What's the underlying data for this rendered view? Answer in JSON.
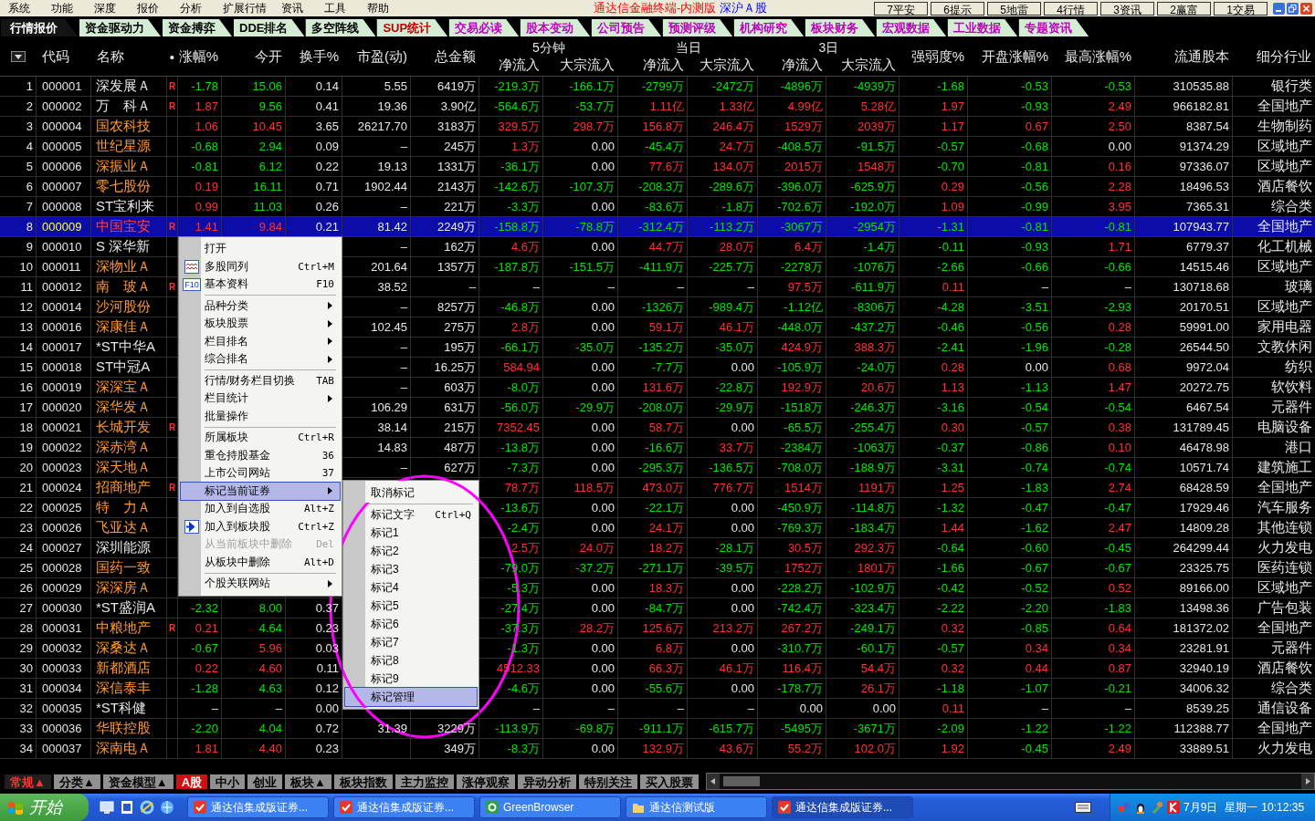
{
  "menubar": {
    "items": [
      "系统",
      "功能",
      "深度",
      "报价",
      "分析",
      "扩展行情",
      "资讯",
      "工具",
      "帮助"
    ],
    "title": "通达信金融终端-内测版",
    "market": "深沪Ａ股",
    "quick_buttons": [
      "7平安",
      "6提示",
      "5地雷",
      "4行情",
      "3资讯",
      "2赢富",
      "1交易"
    ]
  },
  "tabs": [
    {
      "label": "行情报价",
      "color": "#ffffff",
      "selected": true
    },
    {
      "label": "资金驱动力",
      "color": "#000000",
      "selected": false
    },
    {
      "label": "资金搏弈",
      "color": "#000000",
      "selected": false
    },
    {
      "label": "DDE排名",
      "color": "#000000",
      "selected": false
    },
    {
      "label": "多空阵线",
      "color": "#000000",
      "selected": false
    },
    {
      "label": "SUP统计",
      "color": "#c00000",
      "selected": false
    },
    {
      "label": "交易必读",
      "color": "#c000c0",
      "selected": false
    },
    {
      "label": "股本变动",
      "color": "#c000c0",
      "selected": false
    },
    {
      "label": "公司预告",
      "color": "#c000c0",
      "selected": false
    },
    {
      "label": "预测评级",
      "color": "#c000c0",
      "selected": false
    },
    {
      "label": "机构研究",
      "color": "#c000c0",
      "selected": false
    },
    {
      "label": "板块财务",
      "color": "#c000c0",
      "selected": false
    },
    {
      "label": "宏观数据",
      "color": "#c000c0",
      "selected": false
    },
    {
      "label": "工业数据",
      "color": "#c000c0",
      "selected": false
    },
    {
      "label": "专题资讯",
      "color": "#c000c0",
      "selected": false
    }
  ],
  "table": {
    "columns": [
      "代码",
      "名称",
      "•",
      "涨幅%",
      "今开",
      "换手%",
      "市盈(动)",
      "总金额"
    ],
    "groups": [
      {
        "label": "5分钟",
        "sub": [
          "净流入",
          "大宗流入"
        ]
      },
      {
        "label": "当日",
        "sub": [
          "净流入",
          "大宗流入"
        ]
      },
      {
        "label": "3日",
        "sub": [
          "净流入",
          "大宗流入"
        ]
      }
    ],
    "columns_after": [
      "强弱度%",
      "开盘涨幅%",
      "最高涨幅%",
      "流通股本",
      "细分行业"
    ],
    "rows": [
      {
        "no": "1",
        "color": "#e6e6e6",
        "selected": false,
        "open_up": false,
        "cells": [
          "000001",
          "深发展Ａ",
          "R",
          "-1.78",
          "15.06",
          "0.14",
          "5.55",
          "6419万",
          "-219.3万",
          "-166.1万",
          "-2799万",
          "-2472万",
          "-4896万",
          "-4939万",
          "-1.68",
          "-0.53",
          "-0.53",
          "310535.88",
          "银行类"
        ]
      },
      {
        "no": "2",
        "color": "#e6e6e6",
        "selected": false,
        "open_up": false,
        "cells": [
          "000002",
          "万　科Ａ",
          "R",
          "1.87",
          "9.56",
          "0.41",
          "19.36",
          "3.90亿",
          "-564.6万",
          "-53.7万",
          "1.11亿",
          "1.33亿",
          "4.99亿",
          "5.28亿",
          "1.97",
          "-0.93",
          "2.49",
          "966182.81",
          "全国地产"
        ]
      },
      {
        "no": "3",
        "color": "#ff9933",
        "selected": false,
        "open_up": true,
        "cells": [
          "000004",
          "国农科技",
          null,
          "1.06",
          "10.45",
          "3.65",
          "26217.70",
          "3183万",
          "329.5万",
          "298.7万",
          "156.8万",
          "246.4万",
          "1529万",
          "2039万",
          "1.17",
          "0.67",
          "2.50",
          "8387.54",
          "生物制药"
        ]
      },
      {
        "no": "4",
        "color": "#ff9933",
        "selected": false,
        "open_up": false,
        "cells": [
          "000005",
          "世纪星源",
          null,
          "-0.68",
          "2.94",
          "0.09",
          "–",
          "245万",
          "1.3万",
          "0.00",
          "-45.4万",
          "24.7万",
          "-408.5万",
          "-91.5万",
          "-0.57",
          "-0.68",
          "0.00",
          "91374.29",
          "区域地产"
        ]
      },
      {
        "no": "5",
        "color": "#ff9933",
        "selected": false,
        "open_up": false,
        "cells": [
          "000006",
          "深振业Ａ",
          null,
          "-0.81",
          "6.12",
          "0.22",
          "19.13",
          "1331万",
          "-36.1万",
          "0.00",
          "77.6万",
          "134.0万",
          "2015万",
          "1548万",
          "-0.70",
          "-0.81",
          "0.16",
          "97336.07",
          "区域地产"
        ]
      },
      {
        "no": "6",
        "color": "#ff9933",
        "selected": false,
        "open_up": false,
        "cells": [
          "000007",
          "零七股份",
          null,
          "0.19",
          "16.11",
          "0.71",
          "1902.44",
          "2143万",
          "-142.6万",
          "-107.3万",
          "-208.3万",
          "-289.6万",
          "-396.0万",
          "-625.9万",
          "0.29",
          "-0.56",
          "2.28",
          "18496.53",
          "酒店餐饮"
        ]
      },
      {
        "no": "7",
        "color": "#e6e6e6",
        "selected": false,
        "open_up": false,
        "cells": [
          "000008",
          "ST宝利来",
          null,
          "0.99",
          "11.03",
          "0.26",
          "–",
          "221万",
          "-3.3万",
          "0.00",
          "-83.6万",
          "-1.8万",
          "-702.6万",
          "-192.0万",
          "1.09",
          "-0.99",
          "3.95",
          "7365.31",
          "综合类"
        ]
      },
      {
        "no": "8",
        "selected": true,
        "open_up": true,
        "cells": [
          "000009",
          "中国宝安",
          "R",
          "1.41",
          "9.84",
          "0.21",
          "81.42",
          "2249万",
          "-158.8万",
          "-78.8万",
          "-312.4万",
          "-113.2万",
          "-3067万",
          "-2954万",
          "-1.31",
          "-0.81",
          "-0.81",
          "107943.77",
          "全国地产"
        ]
      },
      {
        "no": "9",
        "color": "#e6e6e6",
        "selected": false,
        "cells": [
          "000010",
          "S 深华新",
          null,
          null,
          null,
          null,
          "–",
          "162万",
          "4.6万",
          "0.00",
          "44.7万",
          "28.0万",
          "6.4万",
          "-1.4万",
          "-0.11",
          "-0.93",
          "1.71",
          "6779.37",
          "化工机械"
        ]
      },
      {
        "no": "10",
        "color": "#ff9933",
        "selected": false,
        "cells": [
          "000011",
          "深物业Ａ",
          null,
          null,
          null,
          null,
          "201.64",
          "1357万",
          "-187.8万",
          "-151.5万",
          "-411.9万",
          "-225.7万",
          "-2278万",
          "-1076万",
          "-2.66",
          "-0.66",
          "-0.66",
          "14515.46",
          "区域地产"
        ]
      },
      {
        "no": "11",
        "color": "#ff9933",
        "selected": false,
        "cells": [
          "000012",
          "南　玻Ａ",
          "R",
          null,
          null,
          null,
          "38.52",
          "–",
          "–",
          "–",
          "–",
          "–",
          "97.5万",
          "-611.9万",
          "0.11",
          "–",
          "–",
          "130718.68",
          "玻璃"
        ]
      },
      {
        "no": "12",
        "color": "#ff9933",
        "selected": false,
        "cells": [
          "000014",
          "沙河股份",
          null,
          null,
          null,
          null,
          "–",
          "8257万",
          "-46.8万",
          "0.00",
          "-1326万",
          "-989.4万",
          "-1.12亿",
          "-8306万",
          "-4.28",
          "-3.51",
          "-2.93",
          "20170.51",
          "区域地产"
        ]
      },
      {
        "no": "13",
        "color": "#ff9933",
        "selected": false,
        "cells": [
          "000016",
          "深康佳Ａ",
          null,
          null,
          null,
          null,
          "102.45",
          "275万",
          "2.8万",
          "0.00",
          "59.1万",
          "46.1万",
          "-448.0万",
          "-437.2万",
          "-0.46",
          "-0.56",
          "0.28",
          "59991.00",
          "家用电器"
        ]
      },
      {
        "no": "14",
        "color": "#e6e6e6",
        "selected": false,
        "cells": [
          "000017",
          "*ST中华A",
          null,
          null,
          null,
          null,
          "–",
          "195万",
          "-66.1万",
          "-35.0万",
          "-135.2万",
          "-35.0万",
          "424.9万",
          "388.3万",
          "-2.41",
          "-1.96",
          "-0.28",
          "26544.50",
          "文教休闲"
        ]
      },
      {
        "no": "15",
        "color": "#e6e6e6",
        "selected": false,
        "cells": [
          "000018",
          "ST中冠A",
          null,
          null,
          null,
          null,
          "–",
          "16.25万",
          "584.94",
          "0.00",
          "-7.7万",
          "0.00",
          "-105.9万",
          "-24.0万",
          "0.28",
          "0.00",
          "0.68",
          "9972.04",
          "纺织"
        ]
      },
      {
        "no": "16",
        "color": "#ff9933",
        "selected": false,
        "cells": [
          "000019",
          "深深宝Ａ",
          null,
          null,
          null,
          null,
          "–",
          "603万",
          "-8.0万",
          "0.00",
          "131.6万",
          "-22.8万",
          "192.9万",
          "20.6万",
          "1.13",
          "-1.13",
          "1.47",
          "20272.75",
          "软饮料"
        ]
      },
      {
        "no": "17",
        "color": "#ff9933",
        "selected": false,
        "cells": [
          "000020",
          "深华发Ａ",
          null,
          null,
          null,
          null,
          "106.29",
          "631万",
          "-56.0万",
          "-29.9万",
          "-208.0万",
          "-29.9万",
          "-1518万",
          "-246.3万",
          "-3.16",
          "-0.54",
          "-0.54",
          "6467.54",
          "元器件"
        ]
      },
      {
        "no": "18",
        "color": "#ff9933",
        "selected": false,
        "cells": [
          "000021",
          "长城开发",
          "R",
          null,
          null,
          null,
          "38.14",
          "215万",
          "7352.45",
          "0.00",
          "58.7万",
          "0.00",
          "-65.5万",
          "-255.4万",
          "0.30",
          "-0.57",
          "0.38",
          "131789.45",
          "电脑设备"
        ]
      },
      {
        "no": "19",
        "color": "#ff9933",
        "selected": false,
        "cells": [
          "000022",
          "深赤湾Ａ",
          null,
          null,
          null,
          null,
          "14.83",
          "487万",
          "-13.8万",
          "0.00",
          "-16.6万",
          "33.7万",
          "-2384万",
          "-1063万",
          "-0.37",
          "-0.86",
          "0.10",
          "46478.98",
          "港口"
        ]
      },
      {
        "no": "20",
        "color": "#ff9933",
        "selected": false,
        "cells": [
          "000023",
          "深天地Ａ",
          null,
          null,
          null,
          null,
          "–",
          "627万",
          "-7.3万",
          "0.00",
          "-295.3万",
          "-136.5万",
          "-708.0万",
          "-188.9万",
          "-3.31",
          "-0.74",
          "-0.74",
          "10571.74",
          "建筑施工"
        ]
      },
      {
        "no": "21",
        "color": "#ff9933",
        "selected": false,
        "cells": [
          "000024",
          "招商地产",
          "R",
          null,
          null,
          null,
          null,
          null,
          "78.7万",
          "118.5万",
          "473.0万",
          "776.7万",
          "1514万",
          "1191万",
          "1.25",
          "-1.83",
          "2.74",
          "68428.59",
          "全国地产"
        ]
      },
      {
        "no": "22",
        "color": "#ff9933",
        "selected": false,
        "cells": [
          "000025",
          "特　力Ａ",
          null,
          null,
          null,
          null,
          null,
          null,
          "-13.6万",
          "0.00",
          "-22.1万",
          "0.00",
          "-450.9万",
          "-114.8万",
          "-1.32",
          "-0.47",
          "-0.47",
          "17929.46",
          "汽车服务"
        ]
      },
      {
        "no": "23",
        "color": "#ff9933",
        "selected": false,
        "cells": [
          "000026",
          "飞亚达Ａ",
          null,
          null,
          null,
          null,
          null,
          null,
          "-2.4万",
          "0.00",
          "24.1万",
          "0.00",
          "-769.3万",
          "-183.4万",
          "1.44",
          "-1.62",
          "2.47",
          "14809.28",
          "其他连锁"
        ]
      },
      {
        "no": "24",
        "color": "#e6e6e6",
        "selected": false,
        "cells": [
          "000027",
          "深圳能源",
          null,
          null,
          null,
          null,
          null,
          null,
          "2.5万",
          "24.0万",
          "18.2万",
          "-28.1万",
          "30.5万",
          "292.3万",
          "-0.64",
          "-0.60",
          "-0.45",
          "264299.44",
          "火力发电"
        ]
      },
      {
        "no": "25",
        "color": "#ff9933",
        "selected": false,
        "cells": [
          "000028",
          "国药一致",
          null,
          null,
          null,
          null,
          null,
          null,
          "-79.0万",
          "-37.2万",
          "-271.1万",
          "-39.5万",
          "1752万",
          "1801万",
          "-1.66",
          "-0.67",
          "-0.67",
          "23325.75",
          "医药连锁"
        ]
      },
      {
        "no": "26",
        "color": "#ff9933",
        "selected": false,
        "cells": [
          "000029",
          "深深房Ａ",
          null,
          null,
          null,
          null,
          null,
          null,
          "-5.3万",
          "0.00",
          "18.3万",
          "0.00",
          "-228.2万",
          "-102.9万",
          "-0.42",
          "-0.52",
          "0.52",
          "89166.00",
          "区域地产"
        ]
      },
      {
        "no": "27",
        "color": "#e6e6e6",
        "selected": false,
        "open_up": false,
        "cells": [
          "000030",
          "*ST盛润A",
          null,
          "-2.32",
          "8.00",
          "0.37",
          null,
          null,
          "-27.4万",
          "0.00",
          "-84.7万",
          "0.00",
          "-742.4万",
          "-323.4万",
          "-2.22",
          "-2.20",
          "-1.83",
          "13498.36",
          "广告包装"
        ]
      },
      {
        "no": "28",
        "color": "#ff9933",
        "selected": false,
        "open_up": false,
        "cells": [
          "000031",
          "中粮地产",
          "R",
          "0.21",
          "4.64",
          "0.23",
          null,
          null,
          "-37.3万",
          "28.2万",
          "125.6万",
          "213.2万",
          "267.2万",
          "-249.1万",
          "0.32",
          "-0.85",
          "0.64",
          "181372.02",
          "全国地产"
        ]
      },
      {
        "no": "29",
        "color": "#ff9933",
        "selected": false,
        "open_up": true,
        "cells": [
          "000032",
          "深桑达Ａ",
          null,
          "-0.67",
          "5.96",
          "0.03",
          null,
          null,
          "-1.3万",
          "0.00",
          "6.8万",
          "0.00",
          "-310.7万",
          "-60.1万",
          "-0.57",
          "0.34",
          "0.34",
          "23281.91",
          "元器件"
        ]
      },
      {
        "no": "30",
        "color": "#ff9933",
        "selected": false,
        "open_up": true,
        "cells": [
          "000033",
          "新都酒店",
          null,
          "0.22",
          "4.60",
          "0.11",
          null,
          null,
          "4512.33",
          "0.00",
          "66.3万",
          "46.1万",
          "116.4万",
          "54.4万",
          "0.32",
          "0.44",
          "0.87",
          "32940.19",
          "酒店餐饮"
        ]
      },
      {
        "no": "31",
        "color": "#ff9933",
        "selected": false,
        "open_up": false,
        "cells": [
          "000034",
          "深信泰丰",
          null,
          "-1.28",
          "4.63",
          "0.12",
          null,
          null,
          "-4.6万",
          "0.00",
          "-55.6万",
          "0.00",
          "-178.7万",
          "26.1万",
          "-1.18",
          "-1.07",
          "-0.21",
          "34006.32",
          "综合类"
        ]
      },
      {
        "no": "32",
        "color": "#e6e6e6",
        "selected": false,
        "cells": [
          "000035",
          "*ST科健",
          null,
          "–",
          "–",
          "0.00",
          null,
          null,
          "–",
          "–",
          "–",
          "–",
          "0.00",
          "0.00",
          "0.11",
          "–",
          "–",
          "8539.25",
          "通信设备"
        ]
      },
      {
        "no": "33",
        "color": "#ff9933",
        "selected": false,
        "open_up": false,
        "cells": [
          "000036",
          "华联控股",
          null,
          "-2.20",
          "4.04",
          "0.72",
          "31.39",
          "3229万",
          "-113.9万",
          "-69.8万",
          "-911.1万",
          "-615.7万",
          "-5495万",
          "-3671万",
          "-2.09",
          "-1.22",
          "-1.22",
          "112388.77",
          "全国地产"
        ]
      },
      {
        "no": "34",
        "color": "#ff9933",
        "selected": false,
        "open_up": true,
        "cells": [
          "000037",
          "深南电Ａ",
          null,
          "1.81",
          "4.40",
          "0.23",
          null,
          "349万",
          "-8.3万",
          "0.00",
          "132.9万",
          "43.6万",
          "55.2万",
          "102.0万",
          "1.92",
          "-0.45",
          "2.49",
          "33889.51",
          "火力发电"
        ]
      }
    ]
  },
  "context_menu": {
    "items": [
      {
        "kind": "item",
        "label": "打开",
        "selected": false
      },
      {
        "kind": "item",
        "label": "多股同列",
        "shortcut": "Ctrl+M",
        "selected": false
      },
      {
        "kind": "item",
        "label": "基本资料",
        "shortcut": "F10",
        "icon_label": "F10",
        "selected": false
      },
      {
        "kind": "separator"
      },
      {
        "kind": "item",
        "label": "品种分类",
        "submenu": true,
        "selected": false
      },
      {
        "kind": "item",
        "label": "板块股票",
        "submenu": true,
        "selected": false
      },
      {
        "kind": "item",
        "label": "栏目排名",
        "submenu": true,
        "selected": false
      },
      {
        "kind": "item",
        "label": "综合排名",
        "submenu": true,
        "selected": false
      },
      {
        "kind": "separator"
      },
      {
        "kind": "item",
        "label": "行情/财务栏目切换",
        "shortcut": "TAB",
        "selected": false
      },
      {
        "kind": "item",
        "label": "栏目统计",
        "submenu": true,
        "selected": false
      },
      {
        "kind": "item",
        "label": "批量操作",
        "selected": false
      },
      {
        "kind": "separator"
      },
      {
        "kind": "item",
        "label": "所属板块",
        "shortcut": "Ctrl+R",
        "selected": false
      },
      {
        "kind": "item",
        "label": "重仓持股基金",
        "shortcut": "36",
        "selected": false
      },
      {
        "kind": "item",
        "label": "上市公司网站",
        "shortcut": "37",
        "selected": false
      },
      {
        "kind": "item",
        "label": "标记当前证券",
        "submenu": true,
        "selected": true
      },
      {
        "kind": "item",
        "label": "加入到自选股",
        "shortcut": "Alt+Z",
        "selected": false
      },
      {
        "kind": "item",
        "label": "加入到板块股",
        "shortcut": "Ctrl+Z",
        "selected": false
      },
      {
        "kind": "item",
        "label": "从当前板块中删除",
        "shortcut": "Del",
        "disabled": true,
        "selected": false
      },
      {
        "kind": "item",
        "label": "从板块中删除",
        "shortcut": "Alt+D",
        "selected": false
      },
      {
        "kind": "separator"
      },
      {
        "kind": "item",
        "label": "个股关联网站",
        "submenu": true,
        "selected": false
      }
    ]
  },
  "submenu": {
    "items": [
      {
        "kind": "item",
        "label": "取消标记",
        "selected": false
      },
      {
        "kind": "separator"
      },
      {
        "kind": "item",
        "label": "标记文字",
        "shortcut": "Ctrl+Q",
        "selected": false
      },
      {
        "kind": "item",
        "label": "标记1",
        "selected": false
      },
      {
        "kind": "item",
        "label": "标记2",
        "selected": false
      },
      {
        "kind": "item",
        "label": "标记3",
        "selected": false
      },
      {
        "kind": "item",
        "label": "标记4",
        "selected": false
      },
      {
        "kind": "item",
        "label": "标记5",
        "selected": false
      },
      {
        "kind": "item",
        "label": "标记6",
        "selected": false
      },
      {
        "kind": "item",
        "label": "标记7",
        "selected": false
      },
      {
        "kind": "item",
        "label": "标记8",
        "selected": false
      },
      {
        "kind": "item",
        "label": "标记9",
        "selected": false
      },
      {
        "kind": "item",
        "label": "标记管理",
        "selected": true
      }
    ]
  },
  "bottom_tabs": [
    {
      "label": "常规▲",
      "kind": "menu",
      "selected": false
    },
    {
      "label": "分类▲",
      "kind": "sheet",
      "selected": false
    },
    {
      "label": "资金模型▲",
      "kind": "sheet",
      "selected": false
    },
    {
      "label": "A股",
      "kind": "sheet",
      "selected": true
    },
    {
      "label": "中小",
      "kind": "sheet",
      "selected": false
    },
    {
      "label": "创业",
      "kind": "sheet",
      "selected": false
    },
    {
      "label": "板块▲",
      "kind": "sheet",
      "selected": false
    },
    {
      "label": "板块指数",
      "kind": "sheet",
      "selected": false
    },
    {
      "label": "主力监控",
      "kind": "sheet",
      "selected": false
    },
    {
      "label": "涨停观察",
      "kind": "sheet",
      "selected": false
    },
    {
      "label": "异动分析",
      "kind": "sheet",
      "selected": false
    },
    {
      "label": "特别关注",
      "kind": "sheet",
      "selected": false
    },
    {
      "label": "买入股票",
      "kind": "sheet",
      "selected": false
    }
  ],
  "taskbar": {
    "start": "开始",
    "tasks": [
      {
        "label": "通达信集成版证券...",
        "selected": false
      },
      {
        "label": "通达信集成版证券...",
        "selected": false
      },
      {
        "label": "GreenBrowser",
        "selected": false
      },
      {
        "label": "通达信测试版",
        "selected": false
      },
      {
        "label": "通达信集成版证券...",
        "selected": true
      }
    ],
    "date": "7月9日",
    "weekday": "星期一",
    "time": "10:12:35"
  }
}
